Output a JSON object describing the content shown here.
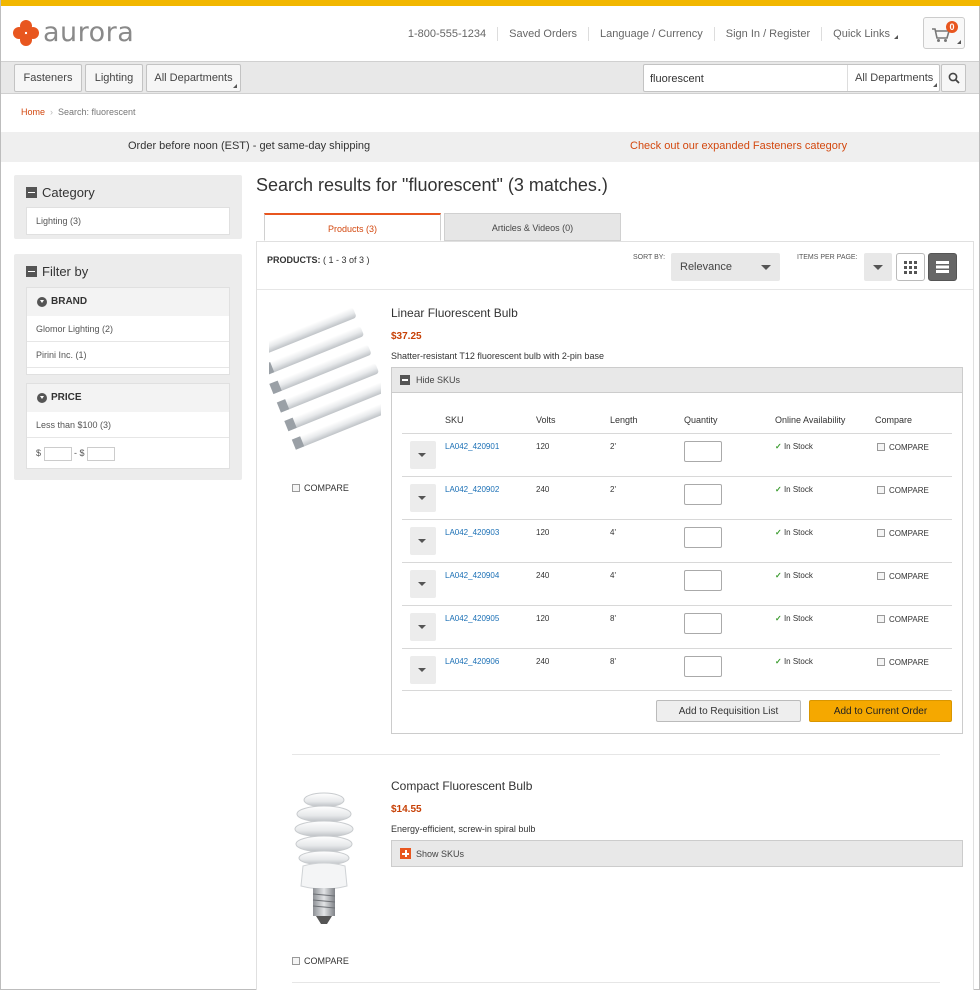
{
  "header": {
    "logo_text": "aurora",
    "links": [
      {
        "label": "1-800-555-1234"
      },
      {
        "label": "Saved Orders"
      },
      {
        "label": "Language / Currency"
      },
      {
        "label": "Sign In / Register"
      },
      {
        "label": "Quick Links"
      }
    ],
    "cart_count": "0"
  },
  "nav": {
    "items": [
      {
        "label": "Fasteners"
      },
      {
        "label": "Lighting"
      },
      {
        "label": "All Departments"
      }
    ],
    "search_value": "fluorescent",
    "search_dept": "All Departments"
  },
  "breadcrumb": {
    "home": "Home",
    "current": "Search: fluorescent"
  },
  "promo": {
    "left": "Order before noon (EST) - get same-day shipping",
    "right": "Check out our expanded Fasteners category"
  },
  "sidebar": {
    "category_title": "Category",
    "category_items": [
      "Lighting (3)"
    ],
    "filter_title": "Filter by",
    "brand_title": "BRAND",
    "brand_items": [
      "Glomor Lighting (2)",
      "Pirini Inc.  (1)"
    ],
    "price_title": "PRICE",
    "price_items": [
      "Less than $100 (3)"
    ],
    "price_from_prefix": "$",
    "price_to_prefix": "- $"
  },
  "results": {
    "title": "Search results for \"fluorescent\" (3 matches.)",
    "tabs": [
      {
        "label": "Products (3)"
      },
      {
        "label": "Articles & Videos (0)"
      }
    ],
    "count_label": "PRODUCTS:",
    "count_value": "( 1 - 3 of 3  )",
    "sort_label": "SORT BY:",
    "sort_value": "Relevance",
    "ipp_label": "ITEMS PER PAGE:"
  },
  "products": [
    {
      "name": "Linear Fluorescent Bulb",
      "price": "$37.25",
      "desc": "Shatter-resistant T12 fluorescent bulb with 2-pin base",
      "compare": "COMPARE",
      "sku_toggle": "Hide SKUs",
      "columns": [
        "SKU",
        "Volts",
        "Length",
        "Quantity",
        "Online Availability",
        "Compare"
      ],
      "skus": [
        {
          "sku": "LA042_420901",
          "volts": "120",
          "length": "2'",
          "avail": "In Stock",
          "compare": "COMPARE"
        },
        {
          "sku": "LA042_420902",
          "volts": "240",
          "length": "2'",
          "avail": "In Stock",
          "compare": "COMPARE"
        },
        {
          "sku": "LA042_420903",
          "volts": "120",
          "length": "4'",
          "avail": "In Stock",
          "compare": "COMPARE"
        },
        {
          "sku": "LA042_420904",
          "volts": "240",
          "length": "4'",
          "avail": "In Stock",
          "compare": "COMPARE"
        },
        {
          "sku": "LA042_420905",
          "volts": "120",
          "length": "8'",
          "avail": "In Stock",
          "compare": "COMPARE"
        },
        {
          "sku": "LA042_420906",
          "volts": "240",
          "length": "8'",
          "avail": "In Stock",
          "compare": "COMPARE"
        }
      ],
      "btn_requisition": "Add to Requisition List",
      "btn_order": "Add to Current Order"
    },
    {
      "name": "Compact Fluorescent Bulb",
      "price": "$14.55",
      "desc": "Energy-efficient, screw-in spiral bulb",
      "compare": "COMPARE",
      "sku_toggle": "Show SKUs"
    }
  ],
  "colors": {
    "accent": "#e8561f",
    "topbar": "#f2b700",
    "link": "#1a6fb5",
    "price": "#c74106",
    "order_button": "#f5a800"
  },
  "icons": [
    "cart-icon",
    "search-icon",
    "grid-view-icon",
    "list-view-icon",
    "checkmark-icon"
  ]
}
